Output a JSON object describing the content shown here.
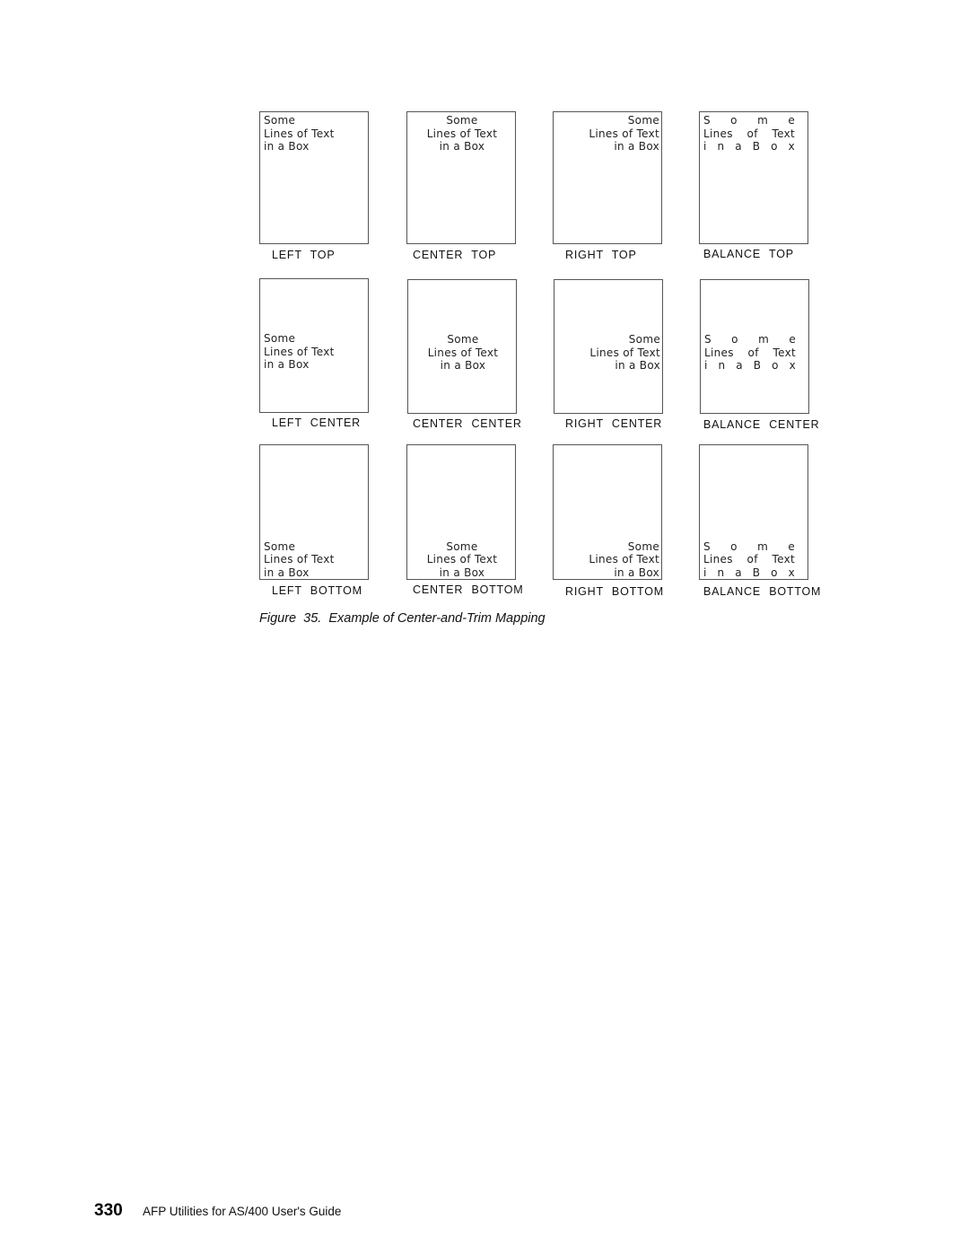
{
  "figure": {
    "box_lines": [
      "Some",
      "Lines of Text",
      "in a Box"
    ],
    "balance_lines": [
      "S o m e",
      "Lines of Text",
      "i n   a  B o x"
    ],
    "labels": {
      "left_top": "LEFT   TOP",
      "center_top": "CENTER   TOP",
      "right_top": "RIGHT   TOP",
      "balance_top": "BALANCE   TOP",
      "left_center": "LEFT   CENTER",
      "center_center": "CENTER   CENTER",
      "right_center": "RIGHT   CENTER",
      "balance_center": "BALANCE   CENTER",
      "left_bottom": "LEFT   BOTTOM",
      "center_bottom": "CENTER   BOTTOM",
      "right_bottom": "RIGHT   BOTTOM",
      "balance_bottom": "BALANCE   BOTTOM"
    },
    "caption": "Figure  35.  Example of Center-and-Trim Mapping"
  },
  "footer": {
    "page_number": "330",
    "book_title": "AFP Utilities for AS/400 User's Guide"
  }
}
